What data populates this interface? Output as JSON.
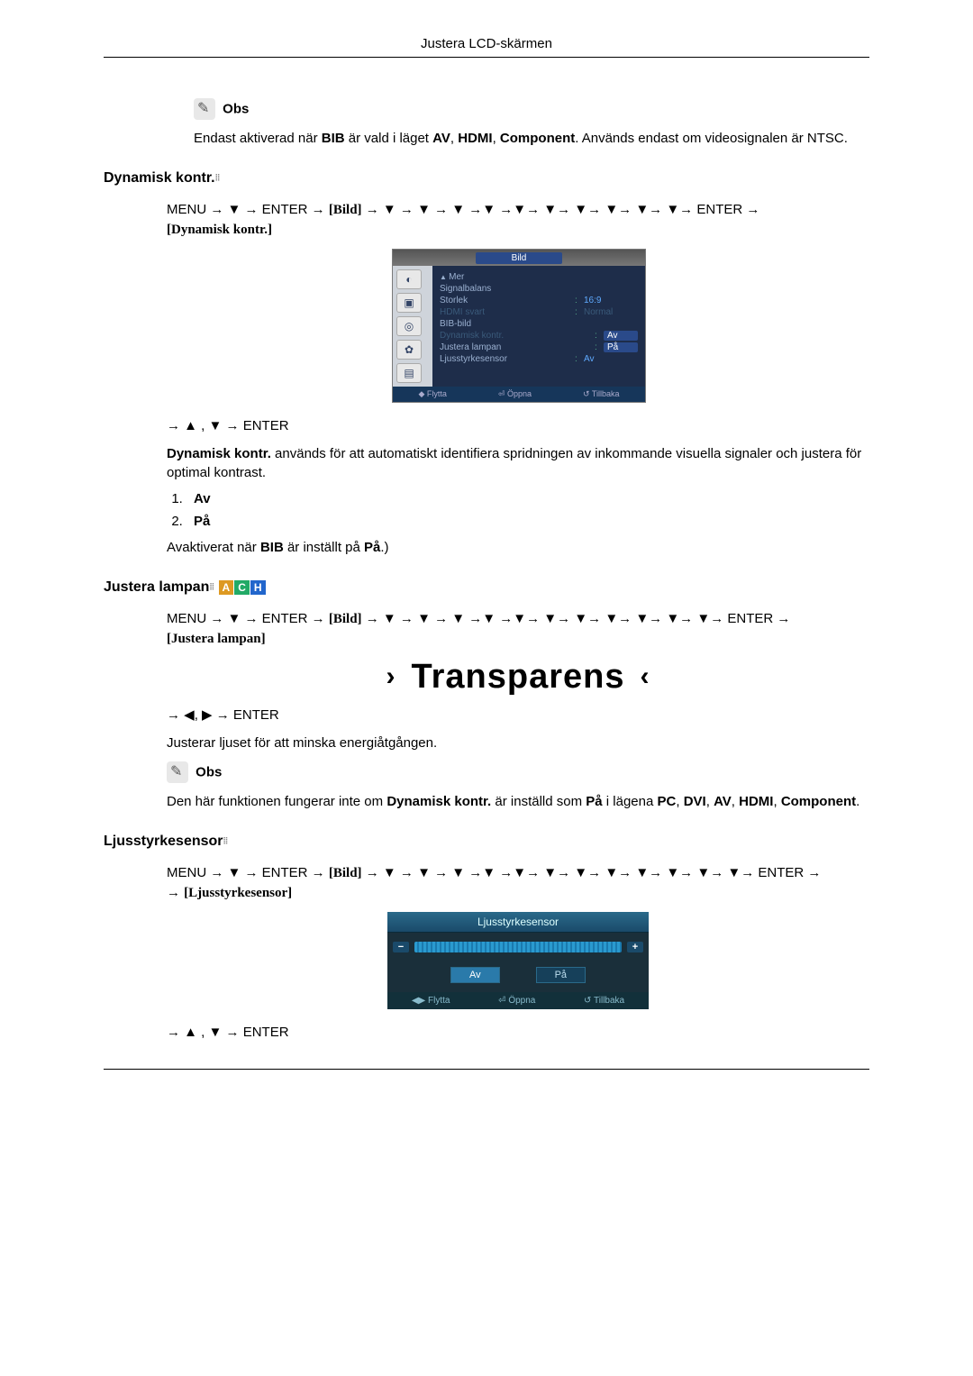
{
  "header": {
    "title": "Justera LCD-skärmen"
  },
  "note_label": "Obs",
  "section1": {
    "note_text_pre": "Endast aktiverad när ",
    "note_text_b1": "BIB",
    "note_text_mid1": " är vald i läget ",
    "note_text_b2": "AV",
    "note_text_c1": ", ",
    "note_text_b3": "HDMI",
    "note_text_c2": ", ",
    "note_text_b4": "Component",
    "note_text_post": ". Används endast om videosignalen är NTSC."
  },
  "dyn": {
    "heading": "Dynamisk kontr.",
    "path_pre": "MENU → ▼ → ENTER → ",
    "path_bild": "[Bild]",
    "path_mid": " → ▼ → ▼ → ▼ →▼ →▼→ ▼→ ▼→ ▼→ ▼→ ▼→ ENTER → ",
    "path_target": "[Dynamisk kontr.]",
    "nav2": "→ ▲ , ▼ → ENTER",
    "desc_b": "Dynamisk kontr.",
    "desc": " används för att automatiskt identifiera spridningen av inkommande visuella signaler och justera för optimal kontrast.",
    "items": [
      "Av",
      "På"
    ],
    "deact_pre": "Avaktiverat när ",
    "deact_b1": "BIB",
    "deact_mid": " är inställt på ",
    "deact_b2": "På",
    "deact_post": ".)"
  },
  "osd1": {
    "tab": "Bild",
    "mer": "Mer",
    "rows": [
      {
        "lbl": "Signalbalans",
        "val": ""
      },
      {
        "lbl": "Storlek",
        "val": "16:9"
      },
      {
        "lbl": "HDMI svart",
        "val": "Normal"
      },
      {
        "lbl": "BIB-bild",
        "val": ""
      },
      {
        "lbl": "Dynamisk kontr.",
        "val": "Av"
      },
      {
        "lbl": "Justera lampan",
        "val": "På"
      },
      {
        "lbl": "Ljusstyrkesensor",
        "val": "Av"
      }
    ],
    "footer": {
      "move": "Flytta",
      "open": "Öppna",
      "back": "Tillbaka"
    }
  },
  "lampan": {
    "heading": "Justera lampan",
    "path_pre": "MENU → ▼ → ENTER → ",
    "path_bild": "[Bild]",
    "path_mid": " → ▼ → ▼ → ▼ →▼ →▼→ ▼→ ▼→ ▼→ ▼→ ▼→ ▼→ ENTER → ",
    "path_target": "[Justera lampan]",
    "big": "Transparens",
    "nav2": "→ ◀, ▶ → ENTER",
    "desc": "Justerar ljuset för att minska energiåtgången.",
    "note_pre": "Den här funktionen fungerar inte om ",
    "note_b1": "Dynamisk kontr.",
    "note_mid": " är inställd som ",
    "note_b2": "På",
    "note_mid2": " i lägena ",
    "note_b3": "PC",
    "c1": ", ",
    "note_b4": "DVI",
    "c2": ", ",
    "note_b5": "AV",
    "c3": ", ",
    "note_b6": "HDMI",
    "c4": ", ",
    "note_b7": "Component",
    "end": "."
  },
  "sensor": {
    "heading": "Ljusstyrkesensor",
    "path_pre": "MENU → ▼ → ENTER → ",
    "path_bild": "[Bild]",
    "path_mid": " → ▼ → ▼ → ▼ →▼ →▼→ ▼→ ▼→ ▼→ ▼→ ▼→ ▼→ ▼→ ENTER → ",
    "path_target": "[Ljusstyrkesensor]",
    "nav2": "→ ▲ , ▼ → ENTER"
  },
  "osd2": {
    "title": "Ljusstyrkesensor",
    "off": "Av",
    "on": "På",
    "footer": {
      "move": "Flytta",
      "open": "Öppna",
      "back": "Tillbaka"
    }
  },
  "badges": {
    "a": "A",
    "c": "C",
    "h": "H"
  }
}
